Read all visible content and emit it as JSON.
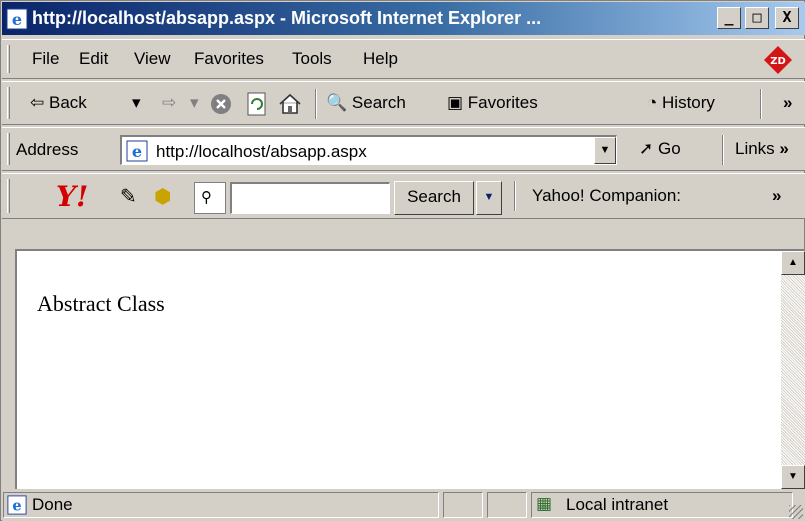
{
  "window": {
    "title": "http://localhost/absapp.aspx - Microsoft Internet Explorer ...",
    "min_label": "_",
    "max_label": "□",
    "close_label": "X"
  },
  "menu": {
    "items": [
      "File",
      "Edit",
      "View",
      "Favorites",
      "Tools",
      "Help"
    ]
  },
  "toolbar": {
    "back_label": "Back",
    "search_label": "Search",
    "favorites_label": "Favorites",
    "history_label": "History",
    "more": "»"
  },
  "address": {
    "label": "Address",
    "url": "http://localhost/absapp.aspx",
    "go_label": "Go",
    "links_label": "Links",
    "more": "»"
  },
  "yahoo": {
    "search_value": "",
    "search_button": "Search",
    "companion_label": "Yahoo! Companion:",
    "more": "»"
  },
  "page": {
    "text": "Abstract Class"
  },
  "status": {
    "text": "Done",
    "zone": "Local intranet"
  },
  "colors": {
    "titlebar_start": "#0a246a",
    "titlebar_end": "#a6caf0",
    "chrome": "#d4d0c8"
  }
}
